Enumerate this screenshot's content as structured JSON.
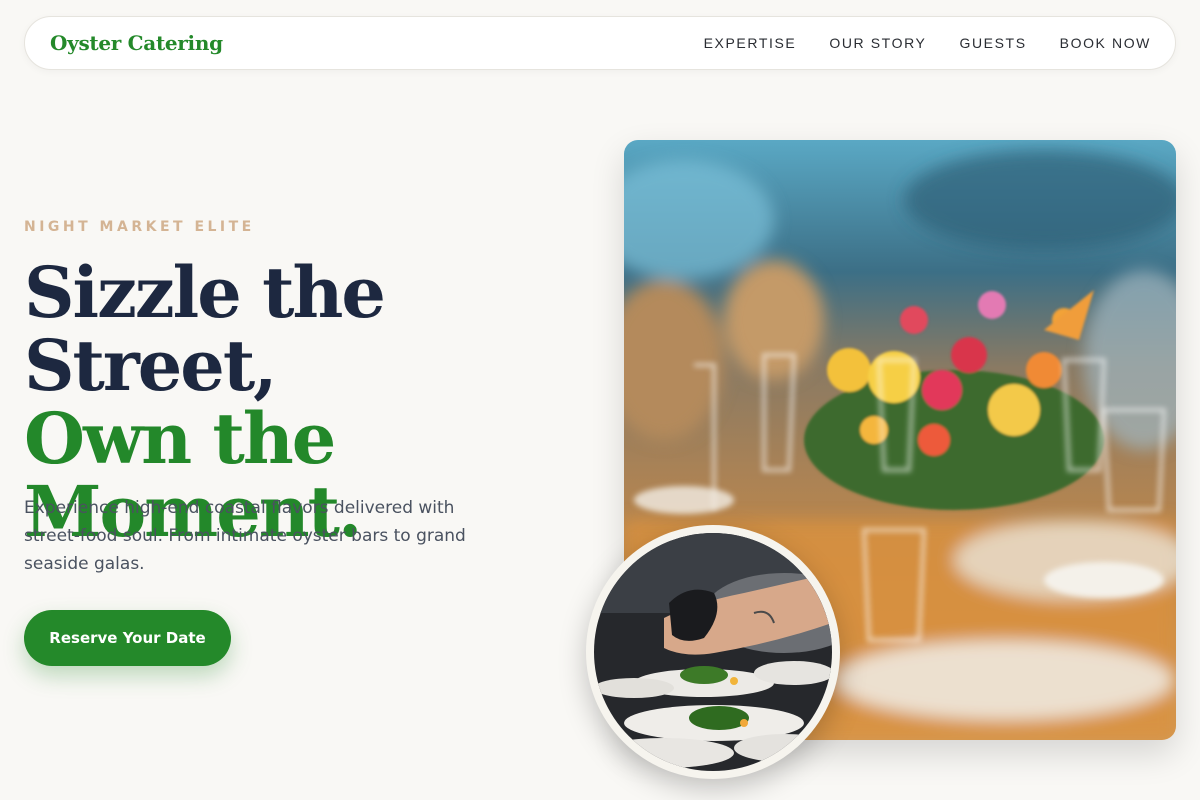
{
  "brand": {
    "logo_text": "Oyster Catering",
    "accent_color": "#24892a",
    "heading_color": "#1d2840",
    "eyebrow_color": "#d4b494"
  },
  "nav": {
    "items": [
      {
        "label": "EXPERTISE"
      },
      {
        "label": "OUR STORY"
      },
      {
        "label": "GUESTS"
      },
      {
        "label": "BOOK NOW"
      }
    ]
  },
  "hero": {
    "eyebrow": "NIGHT MARKET ELITE",
    "headline_line1": "Sizzle the Street,",
    "headline_line2": "Own the",
    "headline_line3": "Moment.",
    "description": "Experience high-end coastal flavors delivered with street-food soul. From intimate oyster bars to grand seaside galas.",
    "cta_label": "Reserve Your Date"
  },
  "images": {
    "main": "banquet-table-floral-centerpiece-photo",
    "inset": "chef-plating-dishes-photo"
  }
}
